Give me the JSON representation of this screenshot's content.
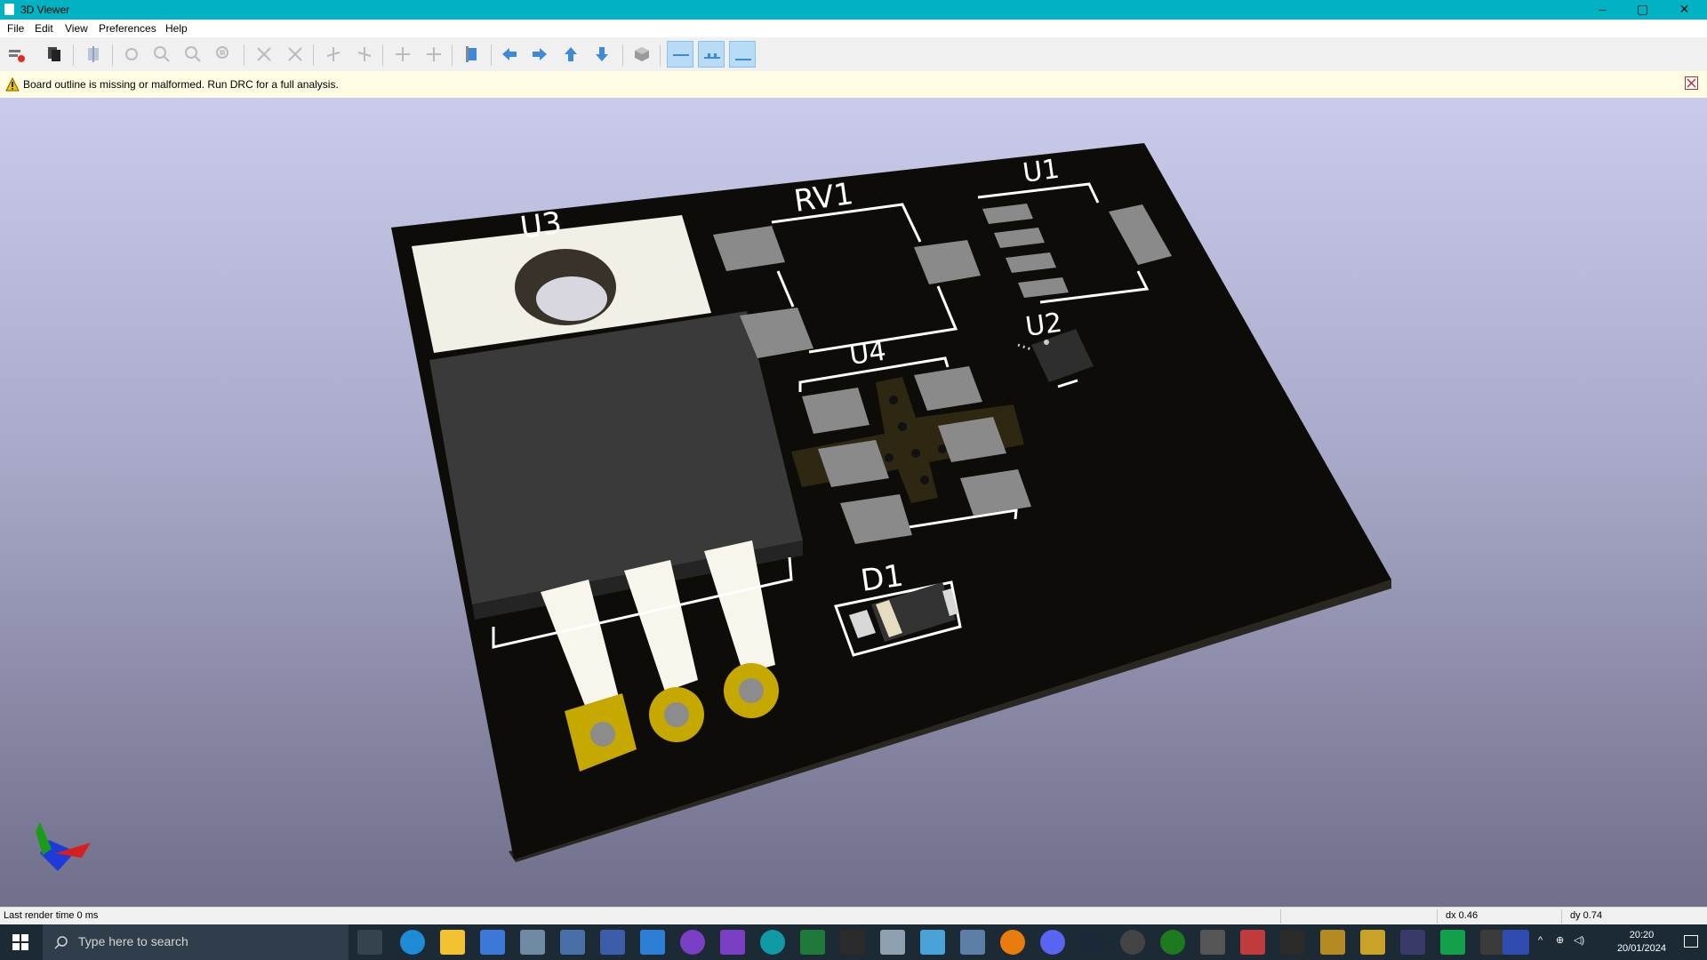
{
  "window": {
    "title": "3D Viewer",
    "controls": {
      "minimize": "–",
      "maximize": "▢",
      "close": "✕"
    }
  },
  "menubar": {
    "items": [
      "File",
      "Edit",
      "View",
      "Preferences",
      "Help"
    ]
  },
  "toolbar": {
    "buttons": [
      "reload-icon",
      "copy-icon",
      "raytrace-icon",
      "refresh-icon",
      "zoom-in-icon",
      "zoom-out-icon",
      "zoom-fit-icon",
      "rotate-x-cw-icon",
      "rotate-x-ccw-icon",
      "rotate-y-cw-icon",
      "rotate-y-ccw-icon",
      "rotate-z-cw-icon",
      "rotate-z-ccw-icon",
      "flip-board-icon",
      "pan-left-icon",
      "pan-right-icon",
      "pan-up-icon",
      "pan-down-icon",
      "ortho-icon",
      "layer-top-icon",
      "layer-mid-icon",
      "layer-bottom-icon"
    ]
  },
  "infobar": {
    "message": "Board outline is missing or malformed. Run DRC for a full analysis."
  },
  "board": {
    "labels": {
      "u3": "U3",
      "rv1": "RV1",
      "u1": "U1",
      "u2": "U2",
      "u4": "U4",
      "d1": "D1"
    }
  },
  "statusbar": {
    "render_time": "Last render time 0 ms",
    "dx": "dx 0.46",
    "dy": "dy 0.74"
  },
  "taskbar": {
    "search_placeholder": "Type here to search",
    "time": "20:20",
    "date": "20/01/2024"
  },
  "colors": {
    "titlebar": "#00b2c2",
    "board": "#0d0c09",
    "pad_gold": "#c5a800",
    "silkscreen": "#ffffff"
  }
}
